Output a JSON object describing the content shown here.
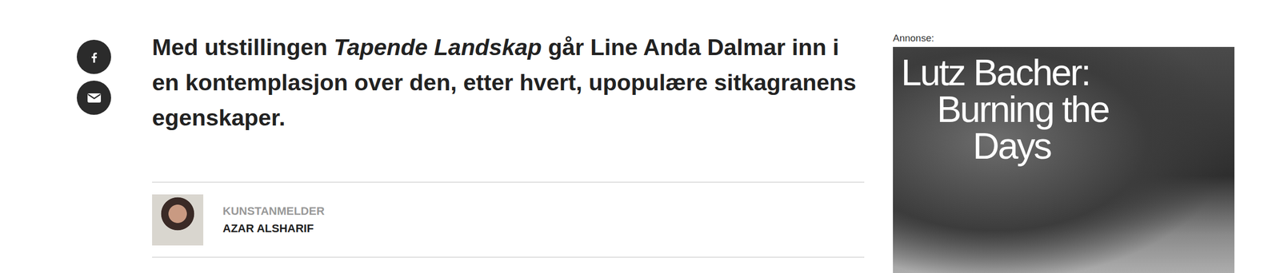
{
  "share": {
    "buttons": [
      {
        "label": "Facebook",
        "kind": "facebook"
      },
      {
        "label": "E-post",
        "kind": "email"
      }
    ]
  },
  "article": {
    "lead": [
      {
        "text": "Med utstillingen ",
        "italic": false
      },
      {
        "text": "Tapende Landskap",
        "italic": true
      },
      {
        "text": " går Line Anda Dalmar inn i en kontemplasjon over den, etter hvert, upopulære sitkagranens egenskaper.",
        "italic": false
      }
    ],
    "author": {
      "role": "KUNSTANMELDER",
      "name": "AZAR ALSHARIF"
    }
  },
  "ad": {
    "label": "Annonse:",
    "title": [
      "Lutz Bacher:",
      "Burning the",
      "Days"
    ]
  }
}
